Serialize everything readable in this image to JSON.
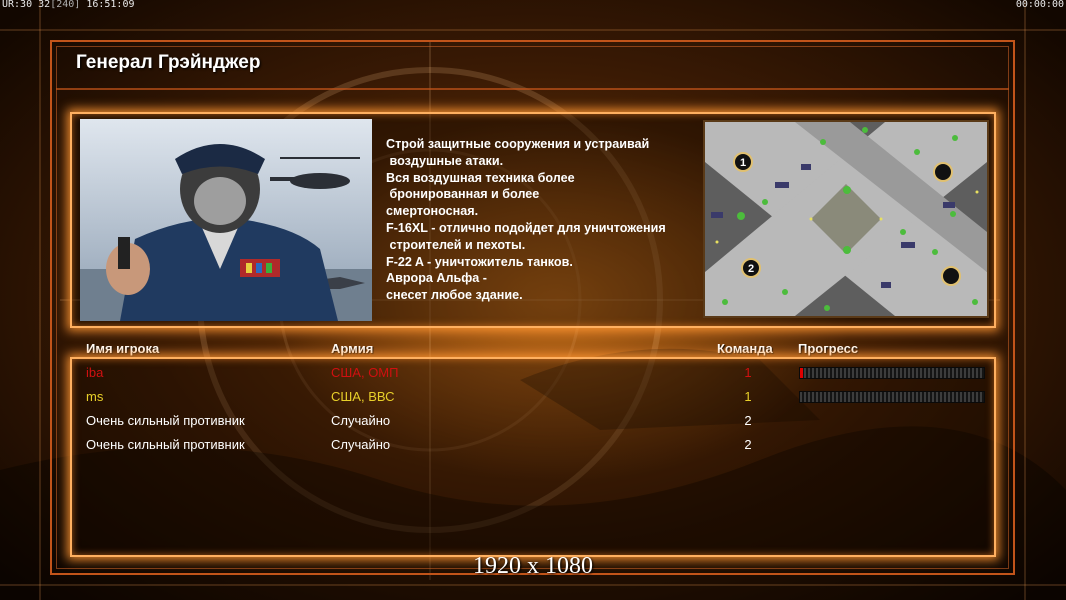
{
  "hud": {
    "left_prefix": "UR:30",
    "left_fps": "32",
    "left_bracket": "[240]",
    "left_time": "16:51:09",
    "right_time": "00:00:00"
  },
  "general": {
    "title": "Генерал Грэйнджер",
    "description_lines": [
      "Строй защитные сооружения и устраивай",
      " воздушные атаки.",
      "Вся воздушная техника более",
      " бронированная и более",
      "смертоносная.",
      "F-16XL - отлично подойдет для уничтожения",
      " строителей и пехоты.",
      "F-22 A - уничтожитель танков.",
      "Аврора Альфа -",
      "снесет любое здание."
    ]
  },
  "minimap": {
    "start_markers": [
      "1",
      "2"
    ]
  },
  "table": {
    "headers": {
      "player": "Имя игрока",
      "army": "Армия",
      "team": "Команда",
      "progress": "Прогресс"
    },
    "rows": [
      {
        "name": "iba",
        "army": "США, ОМП",
        "team": "1",
        "color": "#d01010",
        "progress": 0.01
      },
      {
        "name": "ms",
        "army": "США, ВВС",
        "team": "1",
        "color": "#e8d02a",
        "progress": 0.0
      },
      {
        "name": "Очень сильный противник",
        "army": "Случайно",
        "team": "2",
        "color": "#ffffff"
      },
      {
        "name": "Очень сильный противник",
        "army": "Случайно",
        "team": "2",
        "color": "#ffffff"
      }
    ]
  },
  "resolution": "1920 x 1080",
  "colors": {
    "accent": "#c2541a",
    "glow": "#ffb060",
    "progress_fill": "#e00000"
  }
}
